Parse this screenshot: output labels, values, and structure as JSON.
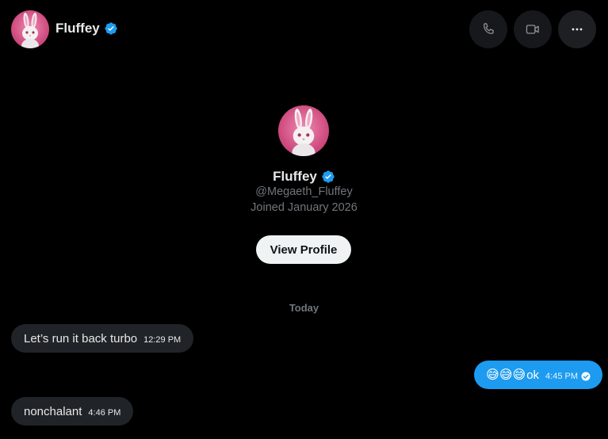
{
  "header": {
    "name": "Fluffey",
    "avatar_icon": "bunny-avatar-icon",
    "verified_icon": "verified-badge-icon",
    "buttons": {
      "call_icon": "phone-icon",
      "video_icon": "video-camera-icon",
      "more_icon": "more-dots-icon"
    }
  },
  "profile": {
    "name": "Fluffey",
    "handle": "@Megaeth_Fluffey",
    "joined": "Joined January 2026",
    "view_profile_label": "View Profile"
  },
  "conversation": {
    "date_label": "Today",
    "messages": [
      {
        "direction": "incoming",
        "text": "Let’s run it back turbo",
        "time": "12:29 PM"
      },
      {
        "direction": "outgoing",
        "emojis": "😅😅😅",
        "text": "ok",
        "time": "4:45 PM",
        "status_icon": "read-check-icon"
      },
      {
        "direction": "incoming",
        "text": "nonchalant",
        "time": "4:46 PM"
      }
    ]
  },
  "colors": {
    "background": "#000000",
    "accent": "#1d9bf0",
    "incoming_bubble": "#202327",
    "muted_text": "#71767b",
    "avatar_pink": "#d94f86"
  }
}
